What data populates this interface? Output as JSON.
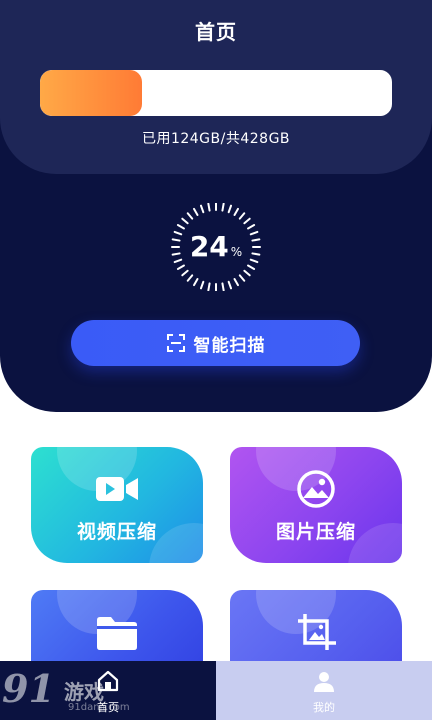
{
  "header": {
    "title": "首页"
  },
  "storage": {
    "used_fraction": 0.29,
    "summary": "已用124GB/共428GB"
  },
  "scan": {
    "percent_value": "24",
    "percent_symbol": "%",
    "button_label": "智能扫描"
  },
  "cards": [
    {
      "label": "视频压缩",
      "icon": "video-icon"
    },
    {
      "label": "图片压缩",
      "icon": "image-icon"
    },
    {
      "label": "",
      "icon": "folder-icon"
    },
    {
      "label": "",
      "icon": "crop-icon"
    }
  ],
  "nav": {
    "home_label": "首页",
    "mine_label": "我的"
  },
  "watermark": {
    "logo": "91",
    "text": "游戏",
    "sub": "91danji.com"
  },
  "colors": {
    "hero_dark": "#0b1240",
    "hero_top": "#1e2657",
    "progress_start": "#ffa947",
    "progress_end": "#ff7b35",
    "scan_button": "#3a5bf7",
    "nav_inactive": "#c8cdf0"
  }
}
